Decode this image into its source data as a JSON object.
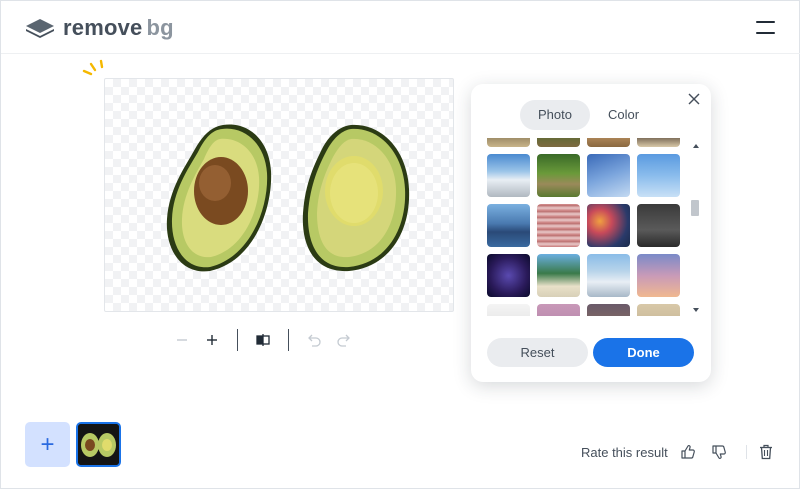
{
  "header": {
    "logo_remove": "remove",
    "logo_bg": "bg",
    "menu_icon": "hamburger-menu-icon"
  },
  "toolbar": {
    "icons": [
      "zoom-out-icon",
      "zoom-in-icon",
      "compare-icon",
      "undo-icon",
      "redo-icon"
    ]
  },
  "background_picker": {
    "tabs": [
      {
        "label": "Photo",
        "active": true
      },
      {
        "label": "Color",
        "active": false
      }
    ],
    "close_icon": "close-icon",
    "reset_label": "Reset",
    "done_label": "Done",
    "thumbnails": [
      "road-partial",
      "forest-road-partial",
      "wood-partial",
      "highway-partial",
      "snowy-road",
      "country-road",
      "blue-sky",
      "sky-clouds",
      "city-skyline",
      "brick-wall",
      "bokeh-lights",
      "dark-gradient",
      "night-sky",
      "palm-beach",
      "snowy-lake",
      "sunset-sky",
      "white-partial",
      "pink-partial",
      "building-partial",
      "interior-partial"
    ]
  },
  "footer": {
    "rate_text": "Rate this result",
    "thumbs_up_icon": "thumbs-up-icon",
    "thumbs_down_icon": "thumbs-down-icon",
    "delete_icon": "trash-icon",
    "add_icon": "plus-icon"
  },
  "colors": {
    "accent": "#1a73e8",
    "add_tile": "#d3e1ff",
    "text": "#454f5b"
  }
}
